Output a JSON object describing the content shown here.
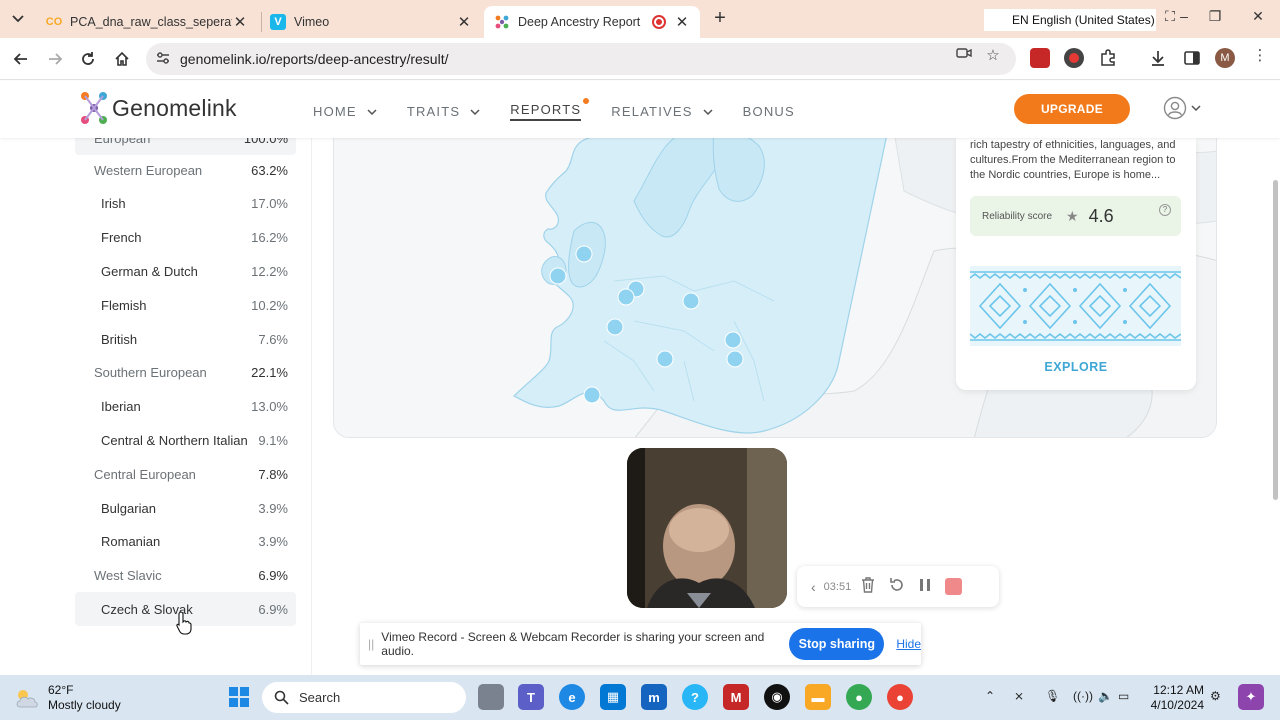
{
  "browser": {
    "tabs": [
      {
        "title": "PCA_dna_raw_class_seperation_"
      },
      {
        "title": "Vimeo"
      },
      {
        "title": "Deep Ancestry Report"
      }
    ],
    "language_indicator": "EN English (United States)",
    "url": "genomelink.io/reports/deep-ancestry/result/",
    "profile_initial": "M"
  },
  "site": {
    "logo_text": "Genomelink",
    "nav": [
      {
        "label": "HOME"
      },
      {
        "label": "TRAITS"
      },
      {
        "label": "REPORTS"
      },
      {
        "label": "RELATIVES"
      },
      {
        "label": "BONUS"
      }
    ],
    "upgrade_label": "UPGRADE",
    "accent_color": "#f27a1a"
  },
  "ancestry": {
    "top_partial": {
      "name": "European",
      "percent": "100.0%"
    },
    "rows": [
      {
        "name": "Western European",
        "percent": "63.2%",
        "kind": "region"
      },
      {
        "name": "Irish",
        "percent": "17.0%",
        "kind": "sub"
      },
      {
        "name": "French",
        "percent": "16.2%",
        "kind": "sub"
      },
      {
        "name": "German & Dutch",
        "percent": "12.2%",
        "kind": "sub"
      },
      {
        "name": "Flemish",
        "percent": "10.2%",
        "kind": "sub"
      },
      {
        "name": "British",
        "percent": "7.6%",
        "kind": "sub"
      },
      {
        "name": "Southern European",
        "percent": "22.1%",
        "kind": "region"
      },
      {
        "name": "Iberian",
        "percent": "13.0%",
        "kind": "sub"
      },
      {
        "name": "Central & Northern Italian",
        "percent": "9.1%",
        "kind": "sub"
      },
      {
        "name": "Central European",
        "percent": "7.8%",
        "kind": "region"
      },
      {
        "name": "Bulgarian",
        "percent": "3.9%",
        "kind": "sub"
      },
      {
        "name": "Romanian",
        "percent": "3.9%",
        "kind": "sub"
      },
      {
        "name": "West Slavic",
        "percent": "6.9%",
        "kind": "region"
      },
      {
        "name": "Czech & Slovak",
        "percent": "6.9%",
        "kind": "sub"
      }
    ]
  },
  "info_card": {
    "description": "rich tapestry of ethnicities, languages, and cultures.From the Mediterranean region to the Nordic countries, Europe is home...",
    "reliability_label": "Reliability score",
    "reliability_value": "4.6",
    "explore_label": "EXPLORE"
  },
  "recorder": {
    "time": "03:51",
    "share_message": "Vimeo Record - Screen & Webcam Recorder is sharing your screen and audio.",
    "stop_label": "Stop sharing",
    "hide_label": "Hide"
  },
  "taskbar": {
    "temperature": "62°F",
    "weather": "Mostly cloudy",
    "search_label": "Search",
    "time": "12:12 AM",
    "date": "4/10/2024"
  }
}
